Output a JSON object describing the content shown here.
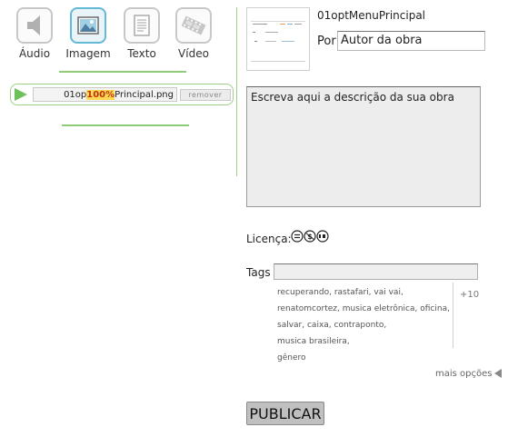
{
  "media_types": [
    {
      "label": "Áudio",
      "icon": "speaker-icon",
      "selected": false
    },
    {
      "label": "Imagem",
      "icon": "image-icon",
      "selected": true
    },
    {
      "label": "Texto",
      "icon": "document-icon",
      "selected": false
    },
    {
      "label": "Vídeo",
      "icon": "film-icon",
      "selected": false
    }
  ],
  "upload": {
    "name_before": "01op",
    "progress": "100%",
    "name_after": "Principal.png",
    "progress_value": 1.0,
    "remove_label": "remover"
  },
  "work": {
    "title": "01optMenuPrincipal",
    "by_label": "Por",
    "author_value": "Autor da obra",
    "description": "Escreva aqui a descrição da sua obra"
  },
  "license": {
    "label": "Licença:",
    "icon": "cc-by-sa-icon"
  },
  "tags": {
    "label": "Tags",
    "value": "",
    "suggestions": [
      "recuperando",
      "rastafari",
      "vai vai",
      "renatomcortez",
      "musica eletrônica",
      "oficina",
      "salvar",
      "caixa",
      "contraponto",
      "musica brasileira",
      "gênero"
    ],
    "more": "+10"
  },
  "more_options": "mais opções",
  "publish": "PUBLICAR",
  "colors": {
    "accent_green": "#8fcc77",
    "selected_blue": "#62b9d8",
    "progress_yellow": "#ffd954"
  }
}
